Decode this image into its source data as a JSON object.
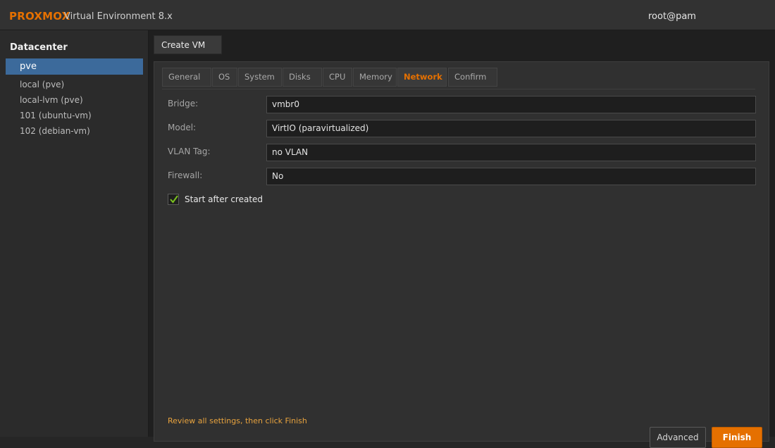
{
  "header": {
    "brand": "PROXMOX",
    "product": "Virtual Environment 8.x",
    "user": "root@pam"
  },
  "sidebar": {
    "title": "Datacenter",
    "items": [
      {
        "label": "pve",
        "selected": true
      },
      {
        "label": "local (pve)"
      },
      {
        "label": "local-lvm (pve)"
      },
      {
        "label": "101 (ubuntu-vm)"
      },
      {
        "label": "102 (debian-vm)"
      }
    ]
  },
  "panel": {
    "tab_label": "Create VM"
  },
  "wizard": {
    "tabs": [
      {
        "label": "General"
      },
      {
        "label": "OS"
      },
      {
        "label": "System"
      },
      {
        "label": "Disks"
      },
      {
        "label": "CPU"
      },
      {
        "label": "Memory"
      },
      {
        "label": "Network",
        "active": true
      },
      {
        "label": "Confirm"
      }
    ],
    "fields": [
      {
        "label": "Bridge:",
        "value": "vmbr0"
      },
      {
        "label": "Model:",
        "value": "VirtIO (paravirtualized)"
      },
      {
        "label": "VLAN Tag:",
        "value": "no VLAN"
      },
      {
        "label": "Firewall:",
        "value": "No"
      }
    ],
    "start_after_created": {
      "label": "Start after created",
      "checked": true
    },
    "hint": "Review all settings, then click Finish",
    "buttons": {
      "advanced": "Advanced",
      "finish": "Finish"
    }
  },
  "colors": {
    "accent": "#e57000",
    "selected": "#3c6a9b",
    "check": "#7bc21f"
  }
}
